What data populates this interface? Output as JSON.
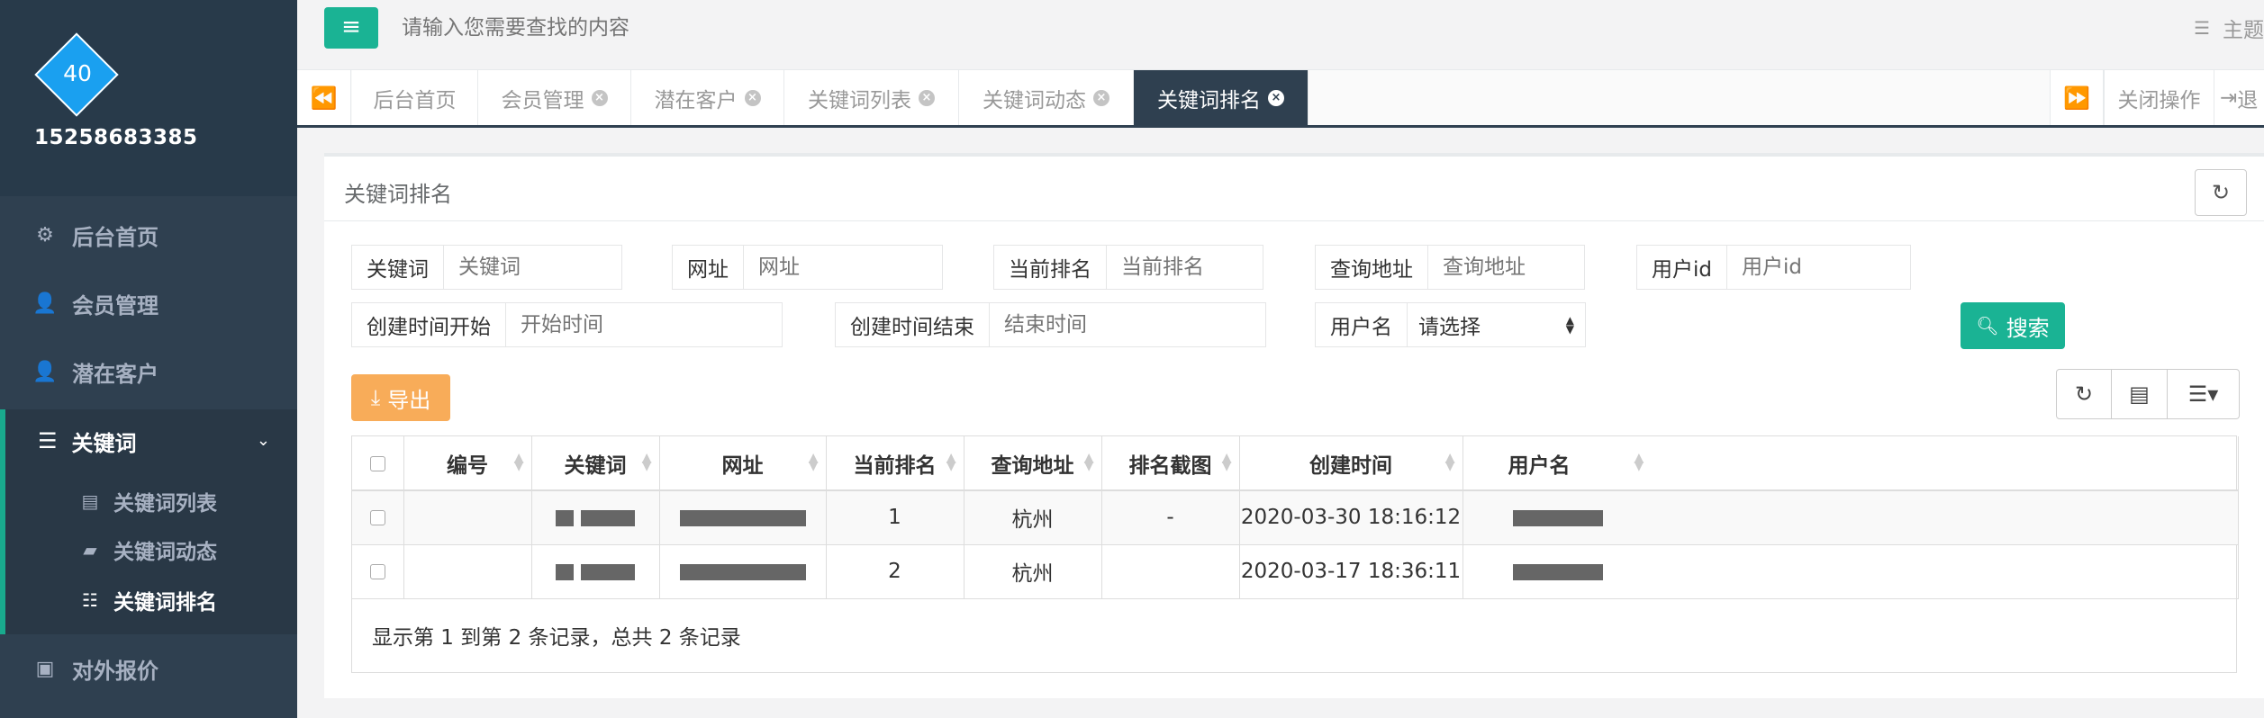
{
  "sidebar": {
    "avatar_number": "40",
    "username": "15258683385",
    "items": [
      {
        "label": "后台首页",
        "icon": "cogs-icon"
      },
      {
        "label": "会员管理",
        "icon": "user-icon"
      },
      {
        "label": "潜在客户",
        "icon": "user-plus-icon"
      }
    ],
    "group": {
      "label": "关键词",
      "icon": "bars-icon",
      "children": [
        {
          "label": "关键词列表",
          "icon": "list-alt-icon"
        },
        {
          "label": "关键词动态",
          "icon": "book-icon"
        },
        {
          "label": "关键词排名",
          "icon": "list-ol-icon"
        }
      ]
    },
    "bottom_item": {
      "label": "对外报价",
      "icon": "money-icon"
    }
  },
  "topbar": {
    "search_placeholder": "请输入您需要查找的内容",
    "theme_label": "主题"
  },
  "tabs": {
    "items": [
      {
        "label": "后台首页",
        "closable": false
      },
      {
        "label": "会员管理",
        "closable": true
      },
      {
        "label": "潜在客户",
        "closable": true
      },
      {
        "label": "关键词列表",
        "closable": true
      },
      {
        "label": "关键词动态",
        "closable": true
      },
      {
        "label": "关键词排名",
        "closable": true,
        "active": true
      }
    ],
    "close_ops_label": "关闭操作",
    "logout_label": "退"
  },
  "panel": {
    "title": "关键词排名",
    "filters": {
      "keyword": {
        "label": "关键词",
        "placeholder": "关键词"
      },
      "url": {
        "label": "网址",
        "placeholder": "网址"
      },
      "current_rank": {
        "label": "当前排名",
        "placeholder": "当前排名"
      },
      "query_location": {
        "label": "查询地址",
        "placeholder": "查询地址"
      },
      "user_id": {
        "label": "用户id",
        "placeholder": "用户id"
      },
      "created_start": {
        "label": "创建时间开始",
        "placeholder": "开始时间"
      },
      "created_end": {
        "label": "创建时间结束",
        "placeholder": "结束时间"
      },
      "username": {
        "label": "用户名",
        "selected": "请选择"
      }
    },
    "search_label": "搜索",
    "export_label": "导出",
    "table": {
      "headers": [
        "编号",
        "关键词",
        "网址",
        "当前排名",
        "查询地址",
        "排名截图",
        "创建时间",
        "用户名"
      ],
      "rows": [
        {
          "rank": "1",
          "location": "杭州",
          "screenshot": "-",
          "created": "2020-03-30 18:16:12"
        },
        {
          "rank": "2",
          "location": "杭州",
          "screenshot": "",
          "created": "2020-03-17 18:36:11"
        }
      ]
    },
    "footer": "显示第 1 到第 2 条记录，总共 2 条记录"
  },
  "colors": {
    "sidebar_bg": "#2f4050",
    "primary": "#1ab394",
    "warning": "#f8ac59",
    "avatar": "#1aa0f0"
  }
}
